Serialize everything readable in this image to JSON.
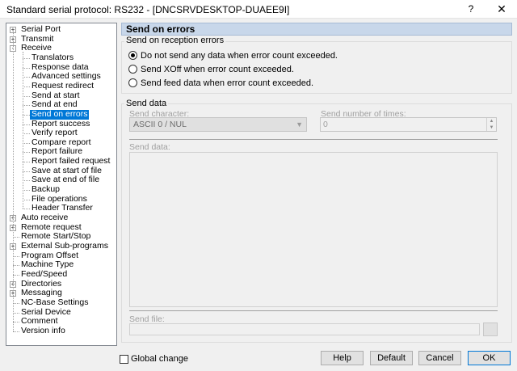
{
  "window": {
    "title": "Standard serial protocol: RS232 - [DNCSRVDESKTOP-DUAEE9I]",
    "help_glyph": "?",
    "close_glyph": "✕"
  },
  "tree": [
    {
      "label": "Serial Port",
      "level": 0,
      "expander": "+"
    },
    {
      "label": "Transmit",
      "level": 0,
      "expander": "+"
    },
    {
      "label": "Receive",
      "level": 0,
      "expander": "-"
    },
    {
      "label": "Translators",
      "level": 1
    },
    {
      "label": "Response data",
      "level": 1
    },
    {
      "label": "Advanced settings",
      "level": 1
    },
    {
      "label": "Request redirect",
      "level": 1
    },
    {
      "label": "Send at start",
      "level": 1
    },
    {
      "label": "Send at end",
      "level": 1
    },
    {
      "label": "Send on errors",
      "level": 1,
      "selected": true
    },
    {
      "label": "Report success",
      "level": 1
    },
    {
      "label": "Verify report",
      "level": 1
    },
    {
      "label": "Compare report",
      "level": 1
    },
    {
      "label": "Report failure",
      "level": 1
    },
    {
      "label": "Report failed request",
      "level": 1
    },
    {
      "label": "Save at start of file",
      "level": 1
    },
    {
      "label": "Save at end of file",
      "level": 1
    },
    {
      "label": "Backup",
      "level": 1
    },
    {
      "label": "File operations",
      "level": 1
    },
    {
      "label": "Header Transfer",
      "level": 1
    },
    {
      "label": "Auto receive",
      "level": 0,
      "expander": "+"
    },
    {
      "label": "Remote request",
      "level": 0,
      "expander": "+"
    },
    {
      "label": "Remote Start/Stop",
      "level": 0
    },
    {
      "label": "External Sub-programs",
      "level": 0,
      "expander": "+"
    },
    {
      "label": "Program Offset",
      "level": 0
    },
    {
      "label": "Machine Type",
      "level": 0
    },
    {
      "label": "Feed/Speed",
      "level": 0
    },
    {
      "label": "Directories",
      "level": 0,
      "expander": "+"
    },
    {
      "label": "Messaging",
      "level": 0,
      "expander": "+"
    },
    {
      "label": "NC-Base Settings",
      "level": 0
    },
    {
      "label": "Serial Device",
      "level": 0
    },
    {
      "label": "Comment",
      "level": 0
    },
    {
      "label": "Version info",
      "level": 0
    }
  ],
  "panel": {
    "header": "Send on errors",
    "reception_group": {
      "label": "Send on reception errors",
      "options": [
        {
          "label": "Do not send any data when error count exceeded.",
          "selected": true
        },
        {
          "label": "Send XOff when error count exceeded.",
          "selected": false
        },
        {
          "label": "Send feed data when error count exceeded.",
          "selected": false
        }
      ]
    },
    "send_data_group": {
      "label": "Send data",
      "send_character_label": "Send character:",
      "send_character_value": "ASCII 0 / NUL",
      "send_times_label": "Send number of times:",
      "send_times_value": "0",
      "send_data_label": "Send data:",
      "send_file_label": "Send file:"
    }
  },
  "footer": {
    "global_change_label": "Global change",
    "buttons": {
      "help": "Help",
      "default": "Default",
      "cancel": "Cancel",
      "ok": "OK"
    }
  },
  "colors": {
    "selection": "#0078d7",
    "header_bg": "#c8d7ea"
  }
}
